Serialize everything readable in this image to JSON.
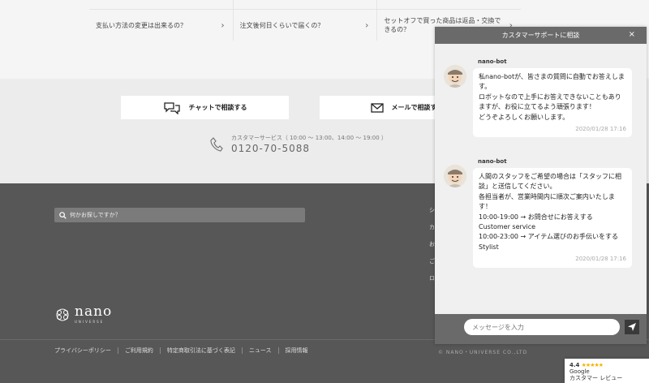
{
  "faq": {
    "items": [
      {
        "label": "支払い方法の変更は出来るの？"
      },
      {
        "label": "注文後何日くらいで届くの？"
      },
      {
        "label": "セットオフで買った商品は返品・交換できるの？"
      }
    ]
  },
  "contact": {
    "chat_label": "チャットで相談する",
    "mail_label": "メールで相談す",
    "phone_hours": "カスタマーサービス（ 10:00 〜 13:00、14:00 〜 19:00 ）",
    "phone_number": "0120-70-5088"
  },
  "footer": {
    "search_placeholder": "何かお探しですか？",
    "column_items": [
      "シ",
      "カ",
      "お",
      "ご",
      "ロ"
    ],
    "logo_main": "nano",
    "logo_sub": "UNIVERSE",
    "links": [
      "プライバシーポリシー",
      "ご利用規約",
      "特定商取引法に基づく表記",
      "ニュース",
      "採用情報"
    ],
    "copyright": "© NANO・UNIVERSE CO.,LTD"
  },
  "chat": {
    "title": "カスタマーサポートに相談",
    "close": "×",
    "messages": [
      {
        "sender": "nano-bot",
        "text": "私nano-botが、皆さまの質問に自動でお答えします。\nロボットなので上手にお答えできないこともありますが、お役に立てるよう頑張ります！\nどうぞよろしくお願いします。",
        "time": "2020/01/28 17:16"
      },
      {
        "sender": "nano-bot",
        "text": "人間のスタッフをご希望の場合は「スタッフに相談」と送信してください。\n各担当者が、営業時間内に順次ご案内いたします！\n10:00-19:00 → お問合せにお答えする\nCustomer service\n10:00-23:00 → アイテム選びのお手伝いをする\nStylist",
        "time": "2020/01/28 17:16"
      }
    ],
    "input_placeholder": "メッセージを入力"
  },
  "google_badge": {
    "rating": "4.4",
    "stars": "★★★★★",
    "brand": "Google",
    "label": "カスタマー レビュー"
  },
  "colors": {
    "footer_bg": "#575757",
    "chat_header": "#6a6a6a",
    "send_button": "#3a3a3a",
    "star": "#f4b400"
  }
}
